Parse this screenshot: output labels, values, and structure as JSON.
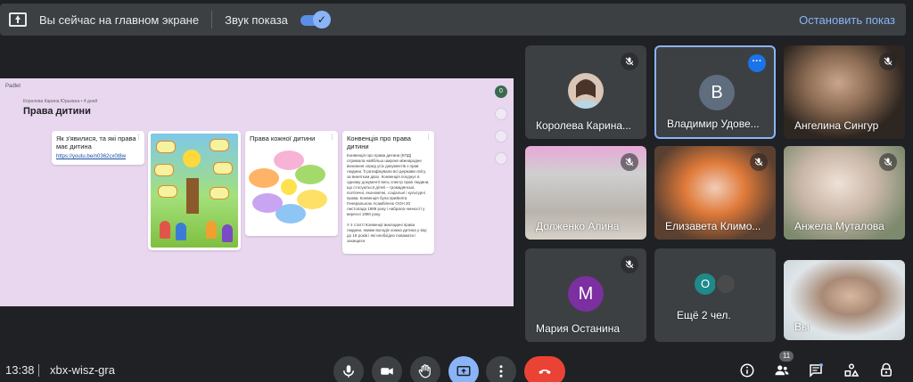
{
  "banner": {
    "presenting_text": "Вы сейчас на главном экране",
    "sound_label": "Звук показа",
    "stop_label": "Остановить показ"
  },
  "presentation": {
    "brand": "Padlet",
    "owner": "Королева Карина Юрьевна • 4 дней",
    "title": "Права дитини",
    "badge": "0",
    "cards": [
      {
        "title": "Як з'явилися, та які права має дитина",
        "link": "https://youtu.be/n0362cx0t8w"
      },
      {
        "title": ""
      },
      {
        "title": "Права кожної дитини"
      },
      {
        "title": "Конвенція про права дитини",
        "text": "Конвенція про права дитини (КПД) отримала найбільш широке міжнародне визнання серед усіх документів з прав людини. Її ратифікували всі держави світу, за винятком двох. Конвенція поєднує в одному документі весь спектр прав людини, що стосуються дітей – громадянські, політичні, економічні, соціальні і культурні права. Конвенція була прийнята Генеральною Асамблеєю ООН 20 листопада 1989 року і набрала чинності у вересні 1990 року.",
        "text2": "У 4 статті Конвенції викладені права людини, якими володіє кожна дитина у віці до 18 років і які необхідно поважати і захищати."
      }
    ],
    "add_label": "+"
  },
  "participants": [
    {
      "name": "Королева Карина...",
      "type": "photo",
      "muted": true
    },
    {
      "name": "Владимир Удове...",
      "type": "initial",
      "initial": "В",
      "color": "#5f6d7e",
      "selected": true
    },
    {
      "name": "Ангелина Сингур",
      "type": "video",
      "muted": true
    },
    {
      "name": "Долженко Алина",
      "type": "video",
      "muted": true
    },
    {
      "name": "Елизавета Климо...",
      "type": "video",
      "muted": true
    },
    {
      "name": "Анжела Муталова",
      "type": "video",
      "muted": true
    },
    {
      "name": "Мария Останина",
      "type": "initial",
      "initial": "М",
      "color": "#7b2fa0",
      "muted": true
    },
    {
      "name": "Ещё 2 чел.",
      "type": "more",
      "initial": "О",
      "color": "#1e8a8a"
    },
    {
      "name": "Вы",
      "type": "video"
    }
  ],
  "bottom": {
    "time": "13:38",
    "code": "xbx-wisz-gra",
    "people_count": "11"
  }
}
